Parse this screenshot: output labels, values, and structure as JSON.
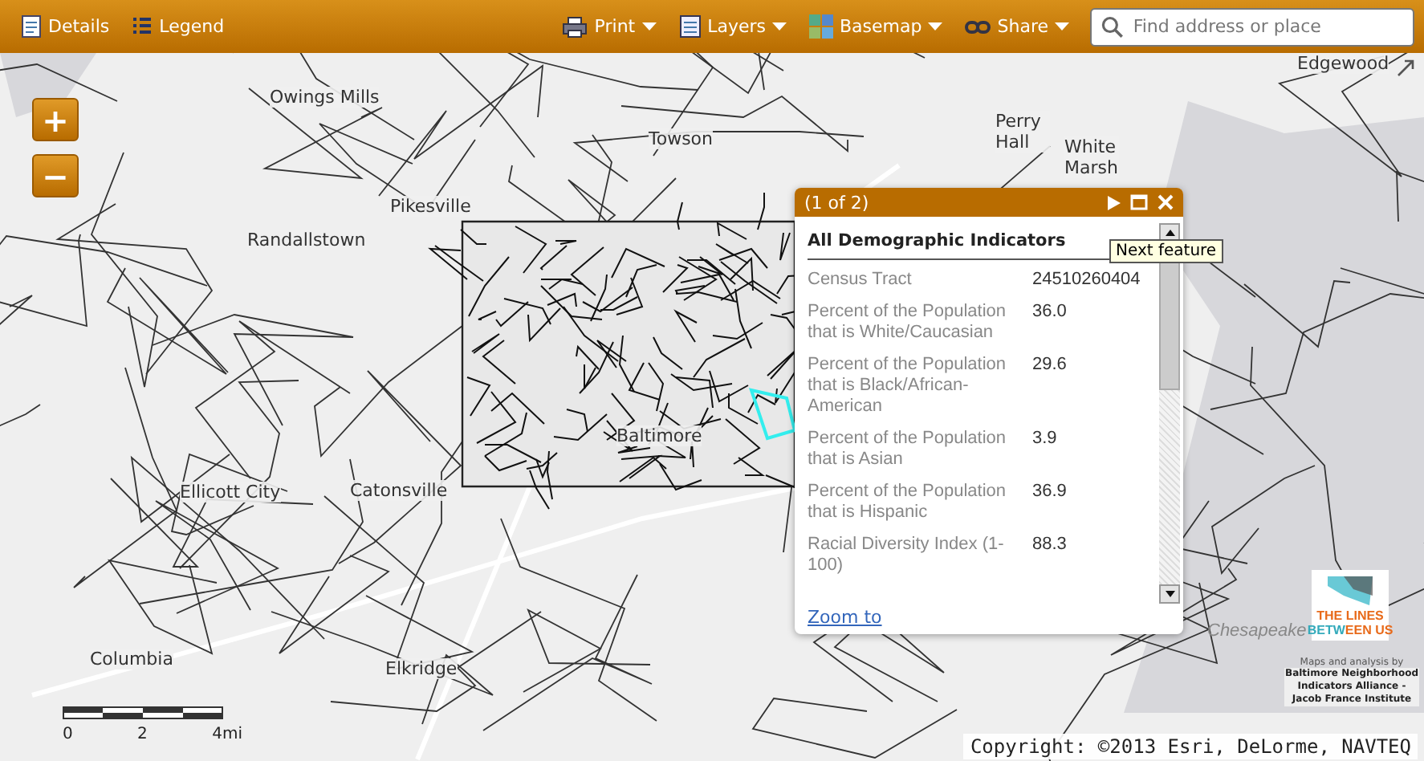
{
  "toolbar": {
    "left_buttons": [
      {
        "kind": "details",
        "label": "Details"
      },
      {
        "kind": "legend",
        "label": "Legend"
      }
    ],
    "menus": [
      {
        "kind": "print",
        "label": "Print"
      },
      {
        "kind": "layers",
        "label": "Layers"
      },
      {
        "kind": "basemap",
        "label": "Basemap"
      },
      {
        "kind": "share",
        "label": "Share"
      }
    ],
    "search": {
      "placeholder": "Find address or place"
    }
  },
  "map": {
    "place_labels": [
      "Edgewood",
      "Owings Mills",
      "Towson",
      "Perry Hall",
      "White Marsh",
      "Pikesville",
      "Randallstown",
      "Baltimore",
      "Ellicott City",
      "Catonsville",
      "Columbia",
      "Elkridge",
      "Chesapeake"
    ],
    "zoom_buttons": [
      "+",
      "−"
    ],
    "scale_labels": [
      "0",
      "2",
      "4mi"
    ],
    "copyright": "Copyright: ©2013 Esri, DeLorme, NAVTEQ"
  },
  "popup": {
    "counter": "(1 of 2)",
    "tooltip": "Next feature",
    "title": "All Demographic Indicators",
    "rows": [
      {
        "label": "Census Tract",
        "value": "24510260404"
      },
      {
        "label": "Percent of the Population that is White/Caucasian",
        "value": "36.0"
      },
      {
        "label": "Percent of the Population that is Black/African-American",
        "value": "29.6"
      },
      {
        "label": "Percent of the Population that is Asian",
        "value": "3.9"
      },
      {
        "label": "Percent of the Population that is Hispanic",
        "value": "36.9"
      },
      {
        "label": "Racial Diversity Index (1-100)",
        "value": "88.3"
      }
    ],
    "link": "Zoom to"
  },
  "logo": {
    "line_1": "THE LINES",
    "line_2a": "BETW",
    "line_2b": "EEN US"
  },
  "credit": {
    "intro": "Maps and analysis by",
    "org": "Baltimore Neighborhood Indicators Alliance - Jacob France Institute"
  }
}
